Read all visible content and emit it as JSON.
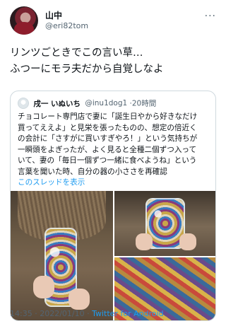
{
  "user": {
    "display_name": "山中",
    "handle": "@eri82tom",
    "more_label": "···"
  },
  "tweet": {
    "lines": [
      "リンツごときでこの言い草…",
      "ふつーにモラ夫だから自覚しなよ"
    ]
  },
  "quote": {
    "display_name": "戌一 いぬいち",
    "handle": "@inu1dog1",
    "time": "·20時間",
    "body_lines": [
      "チョコレート専門店で妻に「誕生日やから好きなだけ",
      "買ってええよ」と見栄を張ったものの、想定の倍近く",
      "の会計に「さすがに買いすぎやろ！」という気持ちが",
      "一瞬頭をよぎったが、よく見ると全種二個ずつ入って",
      "いて、妻の「毎日一個ずつ一緒に食べようね」という",
      "言葉を聞いた時、自分の器の小ささを再確認"
    ],
    "thread_link": "このスレッドを表示"
  },
  "footer": {
    "time": "14:35",
    "sep1": " · ",
    "date": "2022/01/10",
    "sep2": " · ",
    "source": "Twitter for Android"
  }
}
